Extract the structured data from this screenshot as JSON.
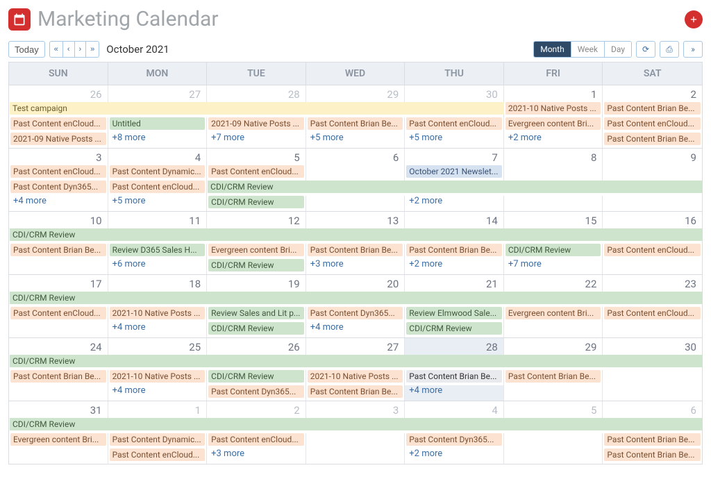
{
  "header": {
    "title": "Marketing Calendar"
  },
  "toolbar": {
    "today": "Today",
    "month_label": "October 2021",
    "views": {
      "month": "Month",
      "week": "Week",
      "day": "Day",
      "active": "Month"
    }
  },
  "day_headers": [
    "SUN",
    "MON",
    "TUE",
    "WED",
    "THU",
    "FRI",
    "SAT"
  ],
  "weeks": [
    {
      "days": [
        {
          "num": "26",
          "cur": false
        },
        {
          "num": "27",
          "cur": false
        },
        {
          "num": "28",
          "cur": false
        },
        {
          "num": "29",
          "cur": false
        },
        {
          "num": "30",
          "cur": false
        },
        {
          "num": "1",
          "cur": true
        },
        {
          "num": "2",
          "cur": true
        }
      ],
      "rows": [
        [
          {
            "start": 0,
            "span": 5,
            "cls": "yellow",
            "label": "Test campaign"
          },
          {
            "start": 5,
            "span": 1,
            "cls": "peach",
            "label": "2021-10 Native Posts ..."
          },
          {
            "start": 6,
            "span": 1,
            "cls": "peach",
            "label": "Past Content Brian Be..."
          }
        ],
        [
          {
            "start": 0,
            "span": 1,
            "cls": "peach",
            "label": "Past Content enCloud..."
          },
          {
            "start": 1,
            "span": 1,
            "cls": "green",
            "label": "Untitled"
          },
          {
            "start": 2,
            "span": 1,
            "cls": "peach",
            "label": "2021-09 Native Posts ..."
          },
          {
            "start": 3,
            "span": 1,
            "cls": "peach",
            "label": "Past Content Brian Be..."
          },
          {
            "start": 4,
            "span": 1,
            "cls": "peach",
            "label": "Past Content enCloud..."
          },
          {
            "start": 5,
            "span": 1,
            "cls": "peach",
            "label": "Evergreen content Bri..."
          },
          {
            "start": 6,
            "span": 1,
            "cls": "peach",
            "label": "Past Content enCloud..."
          }
        ],
        [
          {
            "start": 0,
            "span": 1,
            "cls": "peach",
            "label": "2021-09 Native Posts ..."
          },
          {
            "start": 1,
            "span": 1,
            "cls": "more",
            "label": "+8 more"
          },
          {
            "start": 2,
            "span": 1,
            "cls": "more",
            "label": "+7 more"
          },
          {
            "start": 3,
            "span": 1,
            "cls": "more",
            "label": "+5 more"
          },
          {
            "start": 4,
            "span": 1,
            "cls": "more",
            "label": "+5 more"
          },
          {
            "start": 5,
            "span": 1,
            "cls": "more",
            "label": "+2 more"
          },
          {
            "start": 6,
            "span": 1,
            "cls": "peach",
            "label": "Past Content Brian Be..."
          }
        ]
      ]
    },
    {
      "days": [
        {
          "num": "3",
          "cur": true
        },
        {
          "num": "4",
          "cur": true
        },
        {
          "num": "5",
          "cur": true
        },
        {
          "num": "6",
          "cur": true
        },
        {
          "num": "7",
          "cur": true
        },
        {
          "num": "8",
          "cur": true
        },
        {
          "num": "9",
          "cur": true
        }
      ],
      "rows": [
        [
          {
            "start": 0,
            "span": 1,
            "cls": "peach",
            "label": "Past Content enCloud..."
          },
          {
            "start": 1,
            "span": 1,
            "cls": "peach",
            "label": "Past Content Dynamic..."
          },
          {
            "start": 2,
            "span": 1,
            "cls": "peach",
            "label": "Past Content enCloud..."
          },
          {
            "start": 4,
            "span": 1,
            "cls": "blue",
            "label": "October 2021 Newslet..."
          }
        ],
        [
          {
            "start": 0,
            "span": 1,
            "cls": "peach",
            "label": "Past Content Dyn365..."
          },
          {
            "start": 1,
            "span": 1,
            "cls": "peach",
            "label": "Past Content enCloud..."
          },
          {
            "start": 2,
            "span": 5,
            "cls": "green",
            "label": "CDI/CRM Review"
          }
        ],
        [
          {
            "start": 0,
            "span": 1,
            "cls": "more",
            "label": "+4 more"
          },
          {
            "start": 1,
            "span": 1,
            "cls": "more",
            "label": "+5 more"
          },
          {
            "start": 2,
            "span": 1,
            "cls": "green",
            "label": "CDI/CRM Review"
          },
          {
            "start": 4,
            "span": 1,
            "cls": "more",
            "label": "+2 more"
          }
        ]
      ]
    },
    {
      "days": [
        {
          "num": "10",
          "cur": true
        },
        {
          "num": "11",
          "cur": true
        },
        {
          "num": "12",
          "cur": true
        },
        {
          "num": "13",
          "cur": true
        },
        {
          "num": "14",
          "cur": true
        },
        {
          "num": "15",
          "cur": true
        },
        {
          "num": "16",
          "cur": true
        }
      ],
      "rows": [
        [
          {
            "start": 0,
            "span": 7,
            "cls": "green",
            "label": "CDI/CRM Review"
          }
        ],
        [
          {
            "start": 0,
            "span": 1,
            "cls": "peach",
            "label": "Past Content Brian Be..."
          },
          {
            "start": 1,
            "span": 1,
            "cls": "green",
            "label": "Review D365 Sales H..."
          },
          {
            "start": 2,
            "span": 1,
            "cls": "peach",
            "label": "Evergreen content Bri..."
          },
          {
            "start": 3,
            "span": 1,
            "cls": "peach",
            "label": "Past Content Brian Be..."
          },
          {
            "start": 4,
            "span": 1,
            "cls": "peach",
            "label": "Past Content Brian Be..."
          },
          {
            "start": 5,
            "span": 1,
            "cls": "green",
            "label": "CDI/CRM Review"
          },
          {
            "start": 6,
            "span": 1,
            "cls": "peach",
            "label": "Past Content enCloud..."
          }
        ],
        [
          {
            "start": 1,
            "span": 1,
            "cls": "more",
            "label": "+6 more"
          },
          {
            "start": 2,
            "span": 1,
            "cls": "green",
            "label": "CDI/CRM Review"
          },
          {
            "start": 3,
            "span": 1,
            "cls": "more",
            "label": "+3 more"
          },
          {
            "start": 4,
            "span": 1,
            "cls": "more",
            "label": "+2 more"
          },
          {
            "start": 5,
            "span": 1,
            "cls": "more",
            "label": "+7 more"
          }
        ]
      ]
    },
    {
      "days": [
        {
          "num": "17",
          "cur": true
        },
        {
          "num": "18",
          "cur": true
        },
        {
          "num": "19",
          "cur": true
        },
        {
          "num": "20",
          "cur": true
        },
        {
          "num": "21",
          "cur": true
        },
        {
          "num": "22",
          "cur": true
        },
        {
          "num": "23",
          "cur": true
        }
      ],
      "rows": [
        [
          {
            "start": 0,
            "span": 7,
            "cls": "green",
            "label": "CDI/CRM Review"
          }
        ],
        [
          {
            "start": 0,
            "span": 1,
            "cls": "peach",
            "label": "Past Content enCloud..."
          },
          {
            "start": 1,
            "span": 1,
            "cls": "peach",
            "label": "2021-10 Native Posts ..."
          },
          {
            "start": 2,
            "span": 1,
            "cls": "green",
            "label": "Review Sales and Lit p..."
          },
          {
            "start": 3,
            "span": 1,
            "cls": "peach",
            "label": "Past Content Dyn365..."
          },
          {
            "start": 4,
            "span": 1,
            "cls": "green",
            "label": "Review Elmwood Sale..."
          },
          {
            "start": 5,
            "span": 1,
            "cls": "peach",
            "label": "Evergreen content Bri..."
          },
          {
            "start": 6,
            "span": 1,
            "cls": "peach",
            "label": "Past Content enCloud..."
          }
        ],
        [
          {
            "start": 1,
            "span": 1,
            "cls": "more",
            "label": "+4 more"
          },
          {
            "start": 2,
            "span": 1,
            "cls": "green",
            "label": "CDI/CRM Review"
          },
          {
            "start": 3,
            "span": 1,
            "cls": "more",
            "label": "+4 more"
          },
          {
            "start": 4,
            "span": 1,
            "cls": "green",
            "label": "CDI/CRM Review"
          }
        ]
      ]
    },
    {
      "days": [
        {
          "num": "24",
          "cur": true
        },
        {
          "num": "25",
          "cur": true
        },
        {
          "num": "26",
          "cur": true
        },
        {
          "num": "27",
          "cur": true
        },
        {
          "num": "28",
          "cur": true,
          "today": true
        },
        {
          "num": "29",
          "cur": true
        },
        {
          "num": "30",
          "cur": true
        }
      ],
      "rows": [
        [
          {
            "start": 0,
            "span": 7,
            "cls": "green",
            "label": "CDI/CRM Review"
          }
        ],
        [
          {
            "start": 0,
            "span": 1,
            "cls": "peach",
            "label": "Past Content Brian Be..."
          },
          {
            "start": 1,
            "span": 1,
            "cls": "peach",
            "label": "2021-10 Native Posts ..."
          },
          {
            "start": 2,
            "span": 1,
            "cls": "green",
            "label": "CDI/CRM Review"
          },
          {
            "start": 3,
            "span": 1,
            "cls": "peach",
            "label": "2021-10 Native Posts ..."
          },
          {
            "start": 4,
            "span": 1,
            "cls": "grey",
            "label": "Past Content Brian Be..."
          },
          {
            "start": 5,
            "span": 1,
            "cls": "peach",
            "label": "Past Content Brian Be..."
          }
        ],
        [
          {
            "start": 1,
            "span": 1,
            "cls": "more",
            "label": "+4 more"
          },
          {
            "start": 2,
            "span": 1,
            "cls": "peach",
            "label": "Past Content Dyn365..."
          },
          {
            "start": 3,
            "span": 1,
            "cls": "peach",
            "label": "Past Content Brian Be..."
          },
          {
            "start": 4,
            "span": 1,
            "cls": "more today",
            "label": "+4 more"
          }
        ]
      ]
    },
    {
      "days": [
        {
          "num": "31",
          "cur": true
        },
        {
          "num": "1",
          "cur": false
        },
        {
          "num": "2",
          "cur": false
        },
        {
          "num": "3",
          "cur": false
        },
        {
          "num": "4",
          "cur": false
        },
        {
          "num": "5",
          "cur": false
        },
        {
          "num": "6",
          "cur": false
        }
      ],
      "rows": [
        [
          {
            "start": 0,
            "span": 7,
            "cls": "green",
            "label": "CDI/CRM Review"
          }
        ],
        [
          {
            "start": 0,
            "span": 1,
            "cls": "peach",
            "label": "Evergreen content Bri..."
          },
          {
            "start": 1,
            "span": 1,
            "cls": "peach",
            "label": "Past Content Dynamic..."
          },
          {
            "start": 2,
            "span": 1,
            "cls": "peach",
            "label": "Past Content enCloud..."
          },
          {
            "start": 4,
            "span": 1,
            "cls": "peach",
            "label": "Past Content Dyn365..."
          },
          {
            "start": 6,
            "span": 1,
            "cls": "peach",
            "label": "Past Content Brian Be..."
          }
        ],
        [
          {
            "start": 1,
            "span": 1,
            "cls": "peach",
            "label": "Past Content enCloud..."
          },
          {
            "start": 2,
            "span": 1,
            "cls": "more",
            "label": "+3 more"
          },
          {
            "start": 4,
            "span": 1,
            "cls": "more",
            "label": "+2 more"
          },
          {
            "start": 6,
            "span": 1,
            "cls": "peach",
            "label": "Past Content Brian Be..."
          }
        ]
      ]
    }
  ]
}
